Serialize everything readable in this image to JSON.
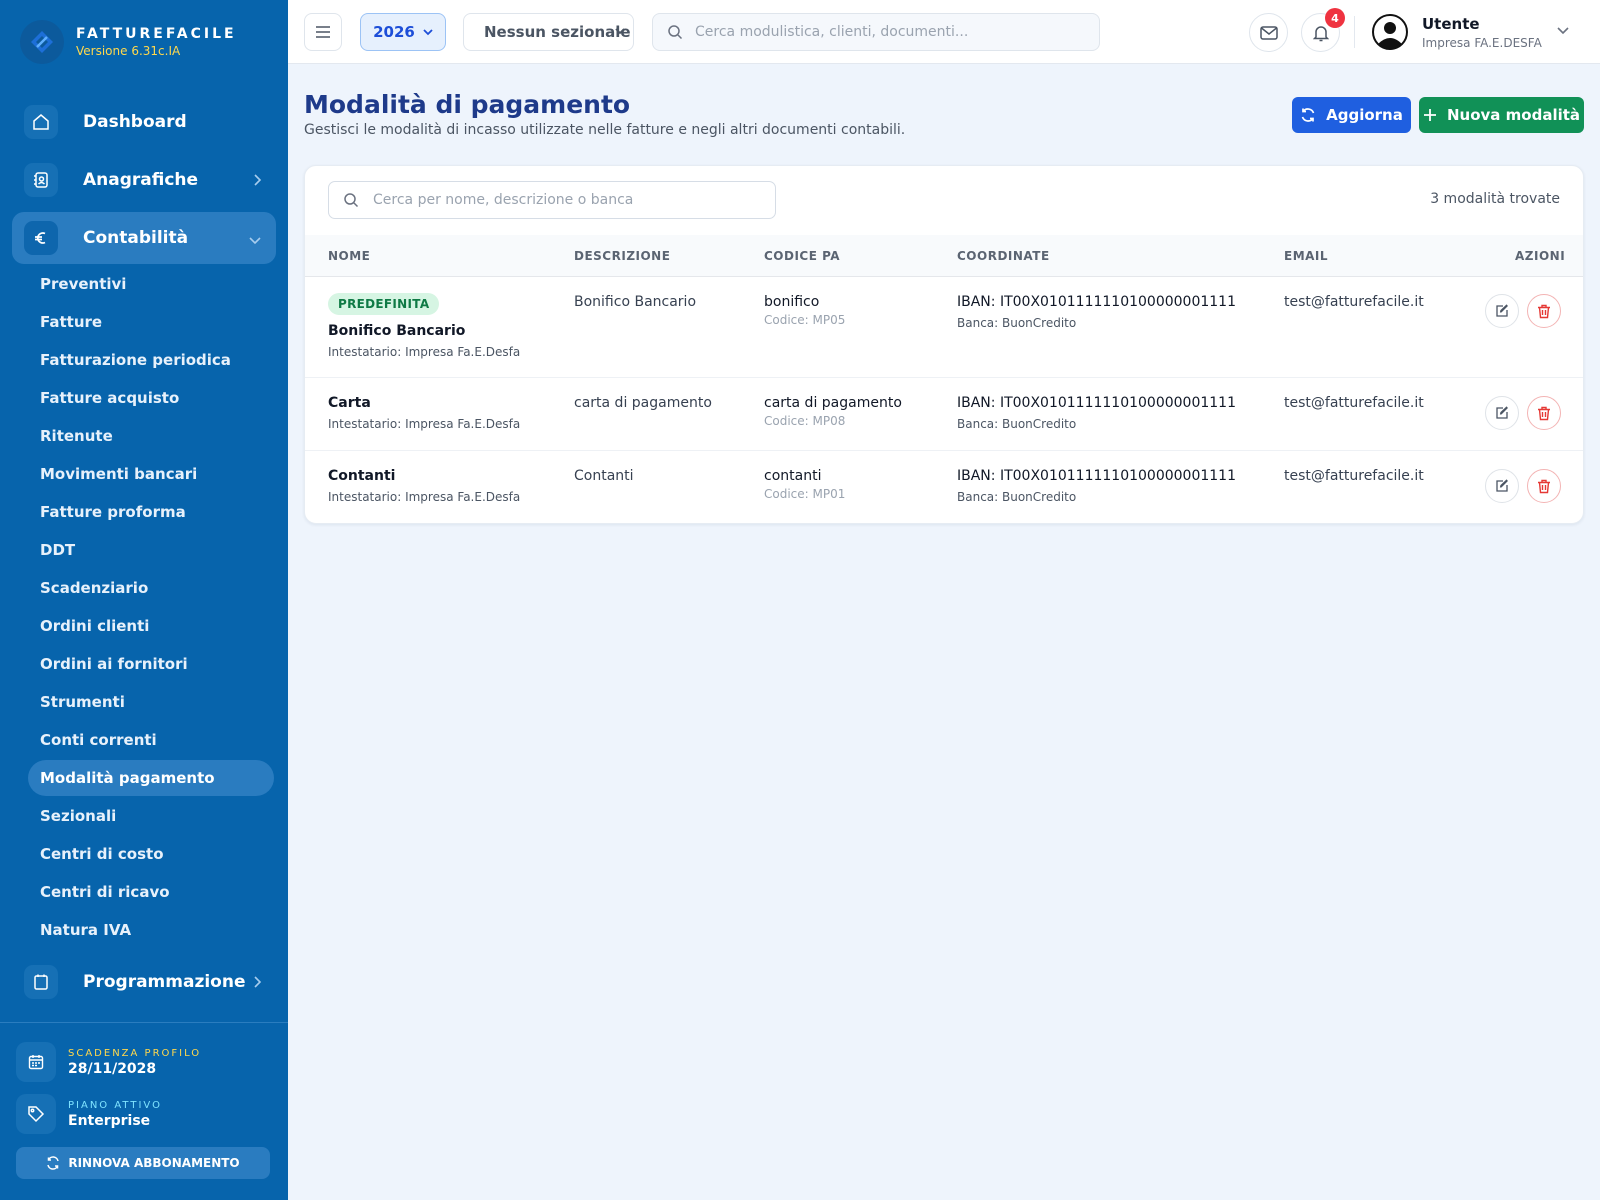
{
  "brand": {
    "name": "FATTUREFACILE",
    "version": "Versione 6.31c.IA"
  },
  "sidebar": {
    "main": [
      {
        "label": "Dashboard",
        "icon": "home-icon"
      },
      {
        "label": "Anagrafiche",
        "icon": "contacts-icon"
      },
      {
        "label": "Contabilità",
        "icon": "euro-icon"
      }
    ],
    "sub_items": [
      {
        "label": "Preventivi"
      },
      {
        "label": "Fatture"
      },
      {
        "label": "Fatturazione periodica"
      },
      {
        "label": "Fatture acquisto"
      },
      {
        "label": "Ritenute"
      },
      {
        "label": "Movimenti bancari"
      },
      {
        "label": "Fatture proforma"
      },
      {
        "label": "DDT"
      },
      {
        "label": "Scadenziario"
      },
      {
        "label": "Ordini clienti"
      },
      {
        "label": "Ordini ai fornitori"
      },
      {
        "label": "Strumenti"
      },
      {
        "label": "Conti correnti"
      },
      {
        "label": "Modalità pagamento"
      },
      {
        "label": "Sezionali"
      },
      {
        "label": "Centri di costo"
      },
      {
        "label": "Centri di ricavo"
      },
      {
        "label": "Natura IVA"
      }
    ],
    "active_sub": "Modalità pagamento",
    "programmazione": {
      "label": "Programmazione",
      "icon": "calendar-icon"
    },
    "expiry": {
      "caption": "SCADENZA PROFILO",
      "value": "28/11/2028"
    },
    "plan": {
      "caption": "PIANO ATTIVO",
      "value": "Enterprise"
    },
    "renew_label": "RINNOVA ABBONAMENTO"
  },
  "topbar": {
    "year": "2026",
    "sezionale": "Nessun sezionale",
    "search_placeholder": "Cerca modulistica, clienti, documenti...",
    "notifications_count": "4",
    "user": {
      "name": "Utente",
      "company": "Impresa FA.E.DESFA"
    }
  },
  "page": {
    "title": "Modalità di pagamento",
    "subtitle": "Gestisci le modalità di incasso utilizzate nelle fatture e negli altri documenti contabili.",
    "refresh_label": "Aggiorna",
    "new_label": "Nuova modalità",
    "search_placeholder": "Cerca per nome, descrizione o banca",
    "result_count": "3 modalità trovate"
  },
  "table": {
    "headers": {
      "nome": "NOME",
      "descrizione": "DESCRIZIONE",
      "codice_pa": "CODICE PA",
      "coordinate": "COORDINATE",
      "email": "EMAIL",
      "azioni": "AZIONI"
    },
    "rows": [
      {
        "tag": "PREDEFINITA",
        "name": "Bonifico Bancario",
        "holder": "Intestatario: Impresa Fa.E.Desfa",
        "description": "Bonifico Bancario",
        "pa": "bonifico",
        "pa_code": "Codice: MP05",
        "iban": "IBAN: IT00X0101111110100000001111",
        "bank": "Banca: BuonCredito",
        "email": "test@fatturefacile.it"
      },
      {
        "tag": "",
        "name": "Carta",
        "holder": "Intestatario: Impresa Fa.E.Desfa",
        "description": "carta di pagamento",
        "pa": "carta di pagamento",
        "pa_code": "Codice: MP08",
        "iban": "IBAN: IT00X0101111110100000001111",
        "bank": "Banca: BuonCredito",
        "email": "test@fatturefacile.it"
      },
      {
        "tag": "",
        "name": "Contanti",
        "holder": "Intestatario: Impresa Fa.E.Desfa",
        "description": "Contanti",
        "pa": "contanti",
        "pa_code": "Codice: MP01",
        "iban": "IBAN: IT00X0101111110100000001111",
        "bank": "Banca: BuonCredito",
        "email": "test@fatturefacile.it"
      }
    ]
  },
  "colors": {
    "sidebar_bg": "#0764ac",
    "accent_blue": "#1f5fe0",
    "accent_green": "#119157",
    "title_blue": "#1e3a8a",
    "danger": "#e53935"
  }
}
